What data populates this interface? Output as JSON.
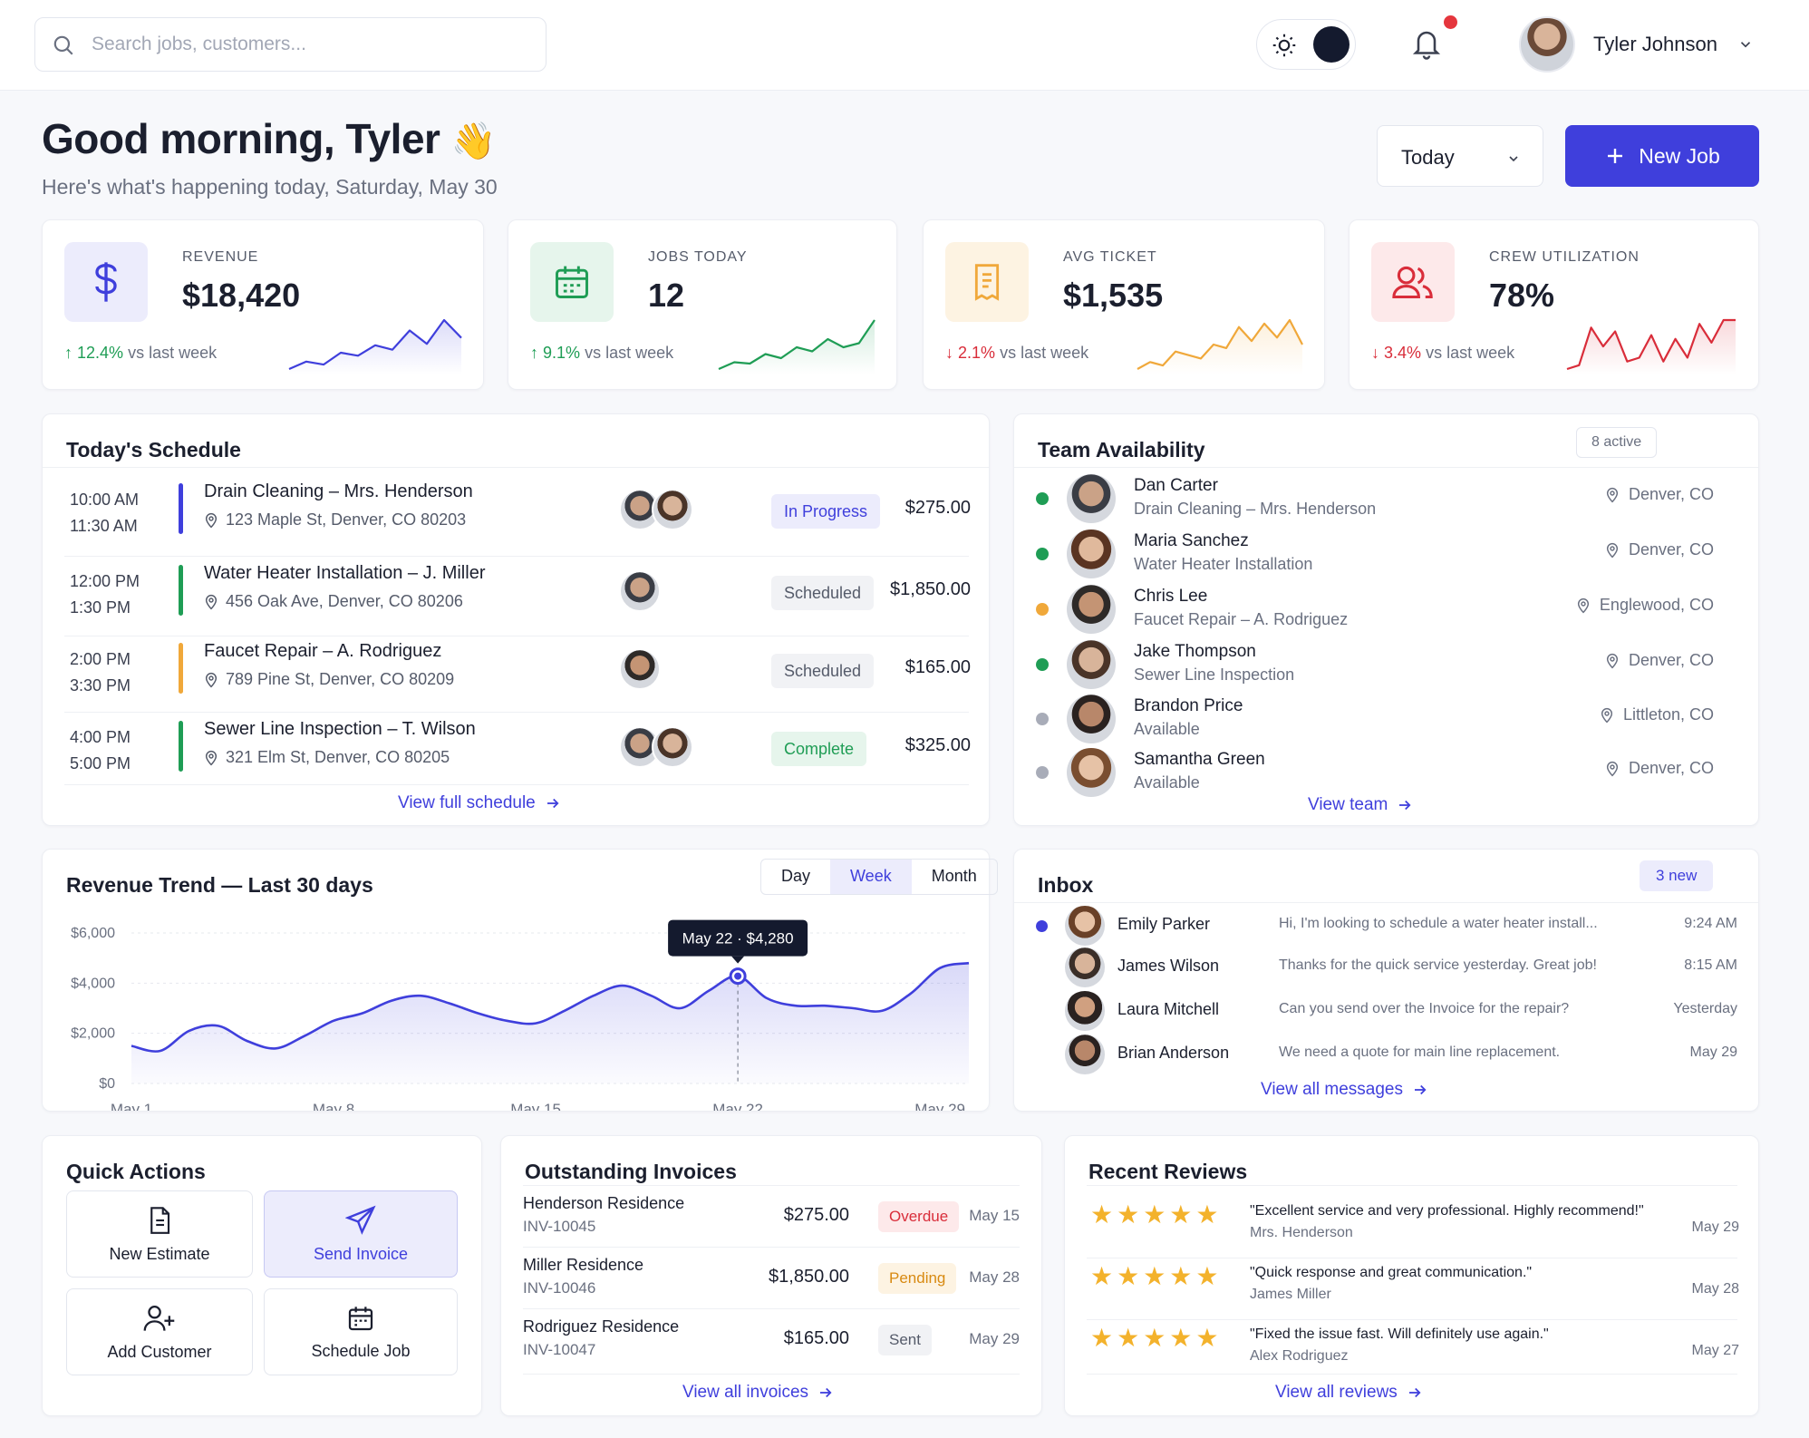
{
  "search": {
    "placeholder": "Search jobs, customers..."
  },
  "user": {
    "name": "Tyler Johnson"
  },
  "header": {
    "greeting": "Good morning, Tyler",
    "emoji": "👋",
    "subtitle": "Here's what's happening today, Saturday, May 30",
    "date_range": "Today",
    "new_job_label": "New Job"
  },
  "colors": {
    "accent": "#3f3fdc",
    "green": "#1f9d55",
    "orange": "#f0a83a",
    "red": "#d92d3a"
  },
  "kpis": [
    {
      "label": "REVENUE",
      "value": "$18,420",
      "change": "12.4%",
      "direction": "up",
      "suffix": "vs last week",
      "icon": "dollar-icon",
      "spark": [
        3,
        4,
        3.6,
        5.2,
        4.8,
        6.2,
        5.6,
        8.2,
        6.4,
        9.6,
        7.2
      ],
      "color": "#3f3fdc"
    },
    {
      "label": "JOBS TODAY",
      "value": "12",
      "change": "9.1%",
      "direction": "up",
      "suffix": "vs last week",
      "icon": "calendar-icon",
      "spark": [
        2,
        3,
        2.8,
        4.2,
        3.6,
        5.2,
        4.6,
        6.4,
        5.2,
        5.8,
        9.2
      ],
      "color": "#1f9d55"
    },
    {
      "label": "AVG TICKET",
      "value": "$1,535",
      "change": "2.1%",
      "direction": "down",
      "suffix": "vs last week",
      "icon": "receipt-icon",
      "spark": [
        3,
        3.4,
        3.2,
        4,
        3.8,
        3.6,
        4.4,
        4.2,
        5.4,
        4.6,
        5.6,
        4.8,
        5.8,
        4.4
      ],
      "color": "#f0a83a"
    },
    {
      "label": "CREW UTILIZATION",
      "value": "78%",
      "change": "3.4%",
      "direction": "down",
      "suffix": "vs last week",
      "icon": "users-icon",
      "spark": [
        3,
        3.2,
        5.2,
        4.2,
        5,
        3.4,
        3.6,
        4.8,
        3.4,
        4.6,
        3.6,
        5.4,
        4.4,
        5.6,
        5.6
      ],
      "color": "#d92d3a"
    }
  ],
  "schedule": {
    "title": "Today's Schedule",
    "link": "View full schedule",
    "items": [
      {
        "start": "10:00 AM",
        "end": "11:30 AM",
        "title": "Drain Cleaning – Mrs. Henderson",
        "address": "123 Maple St, Denver, CO 80203",
        "status": "In Progress",
        "amount": "$275.00",
        "bar": "#3f3fdc",
        "crew": 2
      },
      {
        "start": "12:00 PM",
        "end": "1:30 PM",
        "title": "Water Heater Installation – J. Miller",
        "address": "456 Oak Ave, Denver, CO 80206",
        "status": "Scheduled",
        "amount": "$1,850.00",
        "bar": "#1f9d55",
        "crew": 1
      },
      {
        "start": "2:00 PM",
        "end": "3:30 PM",
        "title": "Faucet Repair – A. Rodriguez",
        "address": "789 Pine St, Denver, CO 80209",
        "status": "Scheduled",
        "amount": "$165.00",
        "bar": "#f0a83a",
        "crew": 1
      },
      {
        "start": "4:00 PM",
        "end": "5:00 PM",
        "title": "Sewer Line Inspection – T. Wilson",
        "address": "321 Elm St, Denver, CO 80205",
        "status": "Complete",
        "amount": "$325.00",
        "bar": "#1f9d55",
        "crew": 2
      }
    ]
  },
  "team": {
    "title": "Team Availability",
    "badge": "8 active",
    "link": "View team",
    "members": [
      {
        "name": "Dan Carter",
        "job": "Drain Cleaning – Mrs. Henderson",
        "location": "Denver, CO",
        "status_color": "#1f9d55"
      },
      {
        "name": "Maria Sanchez",
        "job": "Water Heater Installation",
        "location": "Denver, CO",
        "status_color": "#1f9d55"
      },
      {
        "name": "Chris Lee",
        "job": "Faucet Repair – A. Rodriguez",
        "location": "Englewood, CO",
        "status_color": "#f0a83a"
      },
      {
        "name": "Jake Thompson",
        "job": "Sewer Line Inspection",
        "location": "Denver, CO",
        "status_color": "#1f9d55"
      },
      {
        "name": "Brandon Price",
        "job": "Available",
        "location": "Littleton, CO",
        "status_color": "#a8acb8"
      },
      {
        "name": "Samantha Green",
        "job": "Available",
        "location": "Denver, CO",
        "status_color": "#a8acb8"
      }
    ]
  },
  "revenue_trend": {
    "title": "Revenue Trend — Last 30 days",
    "tabs": [
      "Day",
      "Week",
      "Month"
    ],
    "active_tab": "Week",
    "tooltip": "May 22 · $4,280"
  },
  "chart_data": {
    "type": "area",
    "title": "Revenue Trend — Last 30 days",
    "x": [
      "May 1",
      "May 2",
      "May 3",
      "May 4",
      "May 5",
      "May 6",
      "May 7",
      "May 8",
      "May 9",
      "May 10",
      "May 11",
      "May 12",
      "May 13",
      "May 14",
      "May 15",
      "May 16",
      "May 17",
      "May 18",
      "May 19",
      "May 20",
      "May 21",
      "May 22",
      "May 23",
      "May 24",
      "May 25",
      "May 26",
      "May 27",
      "May 28",
      "May 29",
      "May 30"
    ],
    "series": [
      {
        "values": [
          1500,
          1300,
          2100,
          2300,
          1700,
          1400,
          1900,
          2500,
          2800,
          3300,
          3500,
          3200,
          2800,
          2500,
          2400,
          2900,
          3500,
          3900,
          3500,
          3000,
          3700,
          4280,
          3400,
          3100,
          3100,
          3000,
          2900,
          3600,
          4600,
          4800
        ]
      }
    ],
    "x_ticks": [
      "May 1",
      "May 8",
      "May 15",
      "May 22",
      "May 29"
    ],
    "y_ticks": [
      "$6,000",
      "$4,000",
      "$2,000",
      "$0"
    ],
    "ylim": [
      0,
      6000
    ],
    "grid": true,
    "highlight": {
      "x": "May 22",
      "y": 4280
    }
  },
  "inbox": {
    "title": "Inbox",
    "badge": "3 new",
    "link": "View all messages",
    "messages": [
      {
        "name": "Emily Parker",
        "preview": "Hi, I'm looking to schedule a water heater install...",
        "time": "9:24 AM",
        "unread": true
      },
      {
        "name": "James Wilson",
        "preview": "Thanks for the quick service yesterday. Great job!",
        "time": "8:15 AM",
        "unread": false
      },
      {
        "name": "Laura Mitchell",
        "preview": "Can you send over the Invoice for the repair?",
        "time": "Yesterday",
        "unread": false
      },
      {
        "name": "Brian Anderson",
        "preview": "We need a quote for main line replacement.",
        "time": "May 29",
        "unread": false
      }
    ]
  },
  "quick_actions": {
    "title": "Quick Actions",
    "items": [
      {
        "label": "New Estimate",
        "icon": "document-icon"
      },
      {
        "label": "Send Invoice",
        "icon": "send-icon"
      },
      {
        "label": "Add Customer",
        "icon": "user-plus-icon"
      },
      {
        "label": "Schedule Job",
        "icon": "calendar-icon"
      }
    ]
  },
  "invoices": {
    "title": "Outstanding Invoices",
    "link": "View all invoices",
    "items": [
      {
        "name": "Henderson Residence",
        "number": "INV-10045",
        "amount": "$275.00",
        "status": "Overdue",
        "date": "May 15"
      },
      {
        "name": "Miller Residence",
        "number": "INV-10046",
        "amount": "$1,850.00",
        "status": "Pending",
        "date": "May 28"
      },
      {
        "name": "Rodriguez Residence",
        "number": "INV-10047",
        "amount": "$165.00",
        "status": "Sent",
        "date": "May 29"
      }
    ]
  },
  "reviews": {
    "title": "Recent Reviews",
    "link": "View all reviews",
    "items": [
      {
        "rating": 5,
        "stars": "★★★★★",
        "quote": "\"Excellent service and very professional. Highly recommend!\"",
        "author": "Mrs. Henderson",
        "date": "May 29"
      },
      {
        "rating": 5,
        "stars": "★★★★★",
        "quote": "\"Quick response and great communication.\"",
        "author": "James Miller",
        "date": "May 28"
      },
      {
        "rating": 5,
        "stars": "★★★★★",
        "quote": "\"Fixed the issue fast. Will definitely use again.\"",
        "author": "Alex Rodriguez",
        "date": "May 27"
      }
    ]
  }
}
